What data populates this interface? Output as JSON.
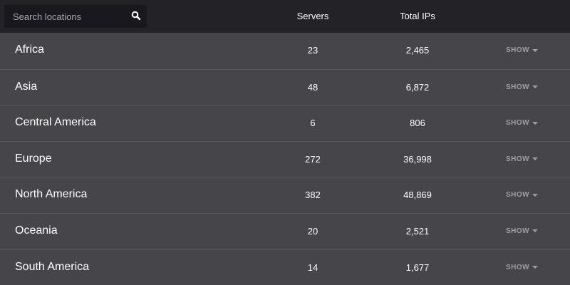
{
  "search": {
    "placeholder": "Search locations"
  },
  "headers": {
    "servers": "Servers",
    "total_ips": "Total IPs"
  },
  "rows": [
    {
      "name": "Africa",
      "servers": "23",
      "ips": "2,465",
      "action": "SHOW"
    },
    {
      "name": "Asia",
      "servers": "48",
      "ips": "6,872",
      "action": "SHOW"
    },
    {
      "name": "Central America",
      "servers": "6",
      "ips": "806",
      "action": "SHOW"
    },
    {
      "name": "Europe",
      "servers": "272",
      "ips": "36,998",
      "action": "SHOW"
    },
    {
      "name": "North America",
      "servers": "382",
      "ips": "48,869",
      "action": "SHOW"
    },
    {
      "name": "Oceania",
      "servers": "20",
      "ips": "2,521",
      "action": "SHOW"
    },
    {
      "name": "South America",
      "servers": "14",
      "ips": "1,677",
      "action": "SHOW"
    }
  ]
}
